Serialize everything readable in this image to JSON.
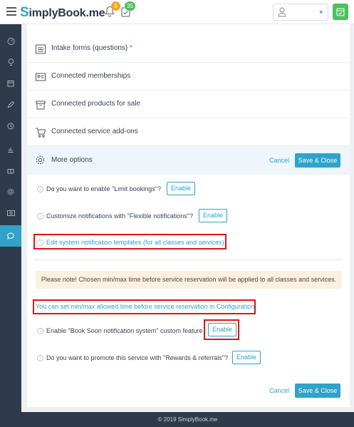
{
  "header": {
    "logo_s": "S",
    "logo_rest": "implyBook",
    "logo_suffix": ".me",
    "notifications_count": "5",
    "tasks_count": "35"
  },
  "sidebar": {
    "items": [
      "dashboard-icon",
      "bulb-icon",
      "calendar-icon",
      "pencil-icon",
      "clock-icon",
      "reports-icon",
      "gift-icon",
      "settings-icon",
      "money-icon",
      "chat-icon"
    ],
    "active_index": 9
  },
  "rows": [
    {
      "label": "Intake forms (questions)",
      "required": "*"
    },
    {
      "label": "Connected memberships"
    },
    {
      "label": "Connected products for sale"
    },
    {
      "label": "Connected service add-ons"
    }
  ],
  "more_options": {
    "label": "More options",
    "cancel": "Cancel",
    "save": "Save & Close"
  },
  "options": {
    "limit_bookings": "Do you want to enable \"Limit bookings\"?",
    "flexible_notifications": "Customize notifications with \"Flexible notifications\"?",
    "edit_templates_link": "Edit system notification templates (for all classes and services)",
    "note": "Please note! Chosen min/max time before service reservation will be applied to all classes and services.",
    "config_link": "You can set min/max allowed time before service reservation in Configuration",
    "book_soon": "Enable \"Book Soon notification system\" custom feature",
    "rewards": "Do you want to promote this service with \"Rewards & referrals\"?",
    "enable_label": "Enable"
  },
  "bottom_actions": {
    "cancel": "Cancel",
    "save": "Save & Close"
  },
  "footer": {
    "text": "© 2019 SimplyBook.me"
  },
  "colors": {
    "accent": "#2fa3c9",
    "sidebar": "#2f3b4c",
    "highlight": "#e01515",
    "green": "#4cc060",
    "orange": "#f4a623"
  }
}
